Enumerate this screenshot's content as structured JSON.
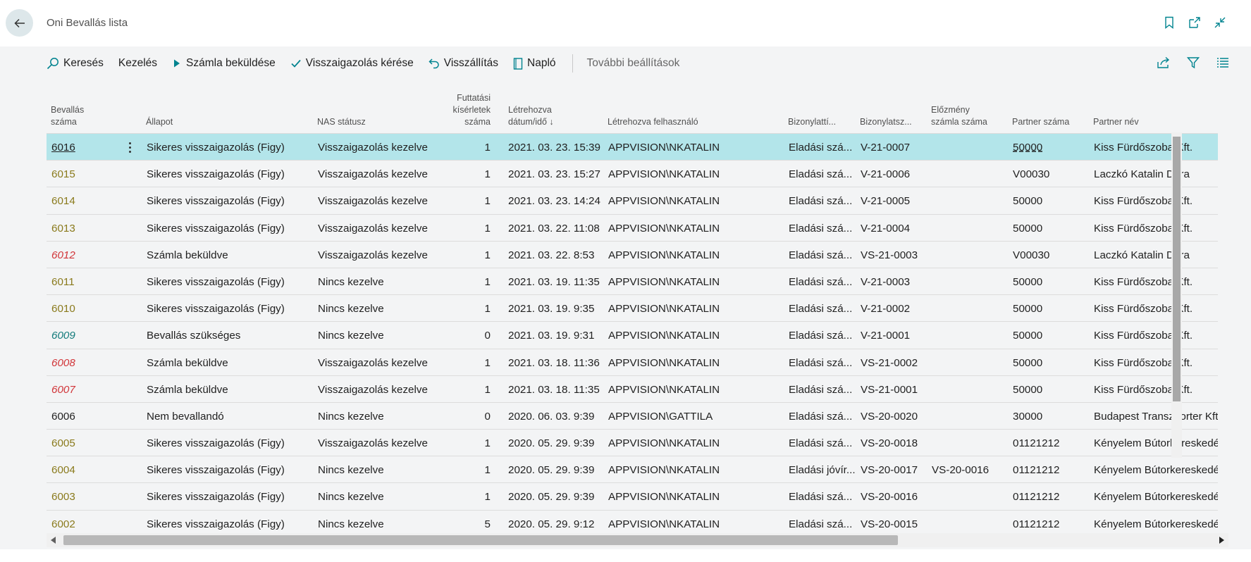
{
  "window": {
    "title": "Oni Bevallás lista",
    "title_icons": [
      "bookmark-icon",
      "open-new-window-icon",
      "collapse-icon"
    ]
  },
  "actions": {
    "search": "Keresés",
    "manage": "Kezelés",
    "send_invoice": "Számla beküldése",
    "request_confirmation": "Visszaigazolás kérése",
    "rollback": "Visszállítás",
    "log": "Napló",
    "more": "További beállítások"
  },
  "colors": {
    "accent": "#00838f",
    "selected_row": "#b3e5ea",
    "olive_link": "#8a7a1c",
    "red_link": "#d13438",
    "teal_link": "#117a7a"
  },
  "columns": [
    [
      "Bevallás",
      "száma"
    ],
    [
      "Állapot"
    ],
    [
      "NAS státusz"
    ],
    [
      "Futtatási",
      "kísérletek",
      "száma"
    ],
    [
      "Létrehozva",
      "dátum/idő ↓"
    ],
    [
      "Létrehozva felhasználó"
    ],
    [
      "Bizonylattí..."
    ],
    [
      "Bizonylatsz..."
    ],
    [
      "Előzmény",
      "számla száma"
    ],
    [
      "Partner száma"
    ],
    [
      "Partner név"
    ]
  ],
  "rows": [
    {
      "no": "6016",
      "no_style": "link",
      "status": "Sikeres visszaigazolás (Figy)",
      "nas": "Visszaigazolás kezelve",
      "attempts": "1",
      "created": "2021. 03. 23. 15:39",
      "user": "APPVISION\\NKATALIN",
      "doc_type": "Eladási szá...",
      "doc_no": "V-21-0007",
      "prev": "",
      "partner_no": "50000",
      "partner_name": "Kiss Fürdőszoba Kft."
    },
    {
      "no": "6015",
      "no_style": "olive",
      "status": "Sikeres visszaigazolás (Figy)",
      "nas": "Visszaigazolás kezelve",
      "attempts": "1",
      "created": "2021. 03. 23. 15:27",
      "user": "APPVISION\\NKATALIN",
      "doc_type": "Eladási szá...",
      "doc_no": "V-21-0006",
      "prev": "",
      "partner_no": "V00030",
      "partner_name": "Laczkó Katalin Dóra"
    },
    {
      "no": "6014",
      "no_style": "olive",
      "status": "Sikeres visszaigazolás (Figy)",
      "nas": "Visszaigazolás kezelve",
      "attempts": "1",
      "created": "2021. 03. 23. 14:24",
      "user": "APPVISION\\NKATALIN",
      "doc_type": "Eladási szá...",
      "doc_no": "V-21-0005",
      "prev": "",
      "partner_no": "50000",
      "partner_name": "Kiss Fürdőszoba Kft."
    },
    {
      "no": "6013",
      "no_style": "olive",
      "status": "Sikeres visszaigazolás (Figy)",
      "nas": "Visszaigazolás kezelve",
      "attempts": "1",
      "created": "2021. 03. 22. 11:08",
      "user": "APPVISION\\NKATALIN",
      "doc_type": "Eladási szá...",
      "doc_no": "V-21-0004",
      "prev": "",
      "partner_no": "50000",
      "partner_name": "Kiss Fürdőszoba Kft."
    },
    {
      "no": "6012",
      "no_style": "red",
      "status": "Számla beküldve",
      "nas": "Visszaigazolás kezelve",
      "attempts": "1",
      "created": "2021. 03. 22. 8:53",
      "user": "APPVISION\\NKATALIN",
      "doc_type": "Eladási szá...",
      "doc_no": "VS-21-0003",
      "prev": "",
      "partner_no": "V00030",
      "partner_name": "Laczkó Katalin Dóra"
    },
    {
      "no": "6011",
      "no_style": "olive",
      "status": "Sikeres visszaigazolás (Figy)",
      "nas": "Nincs kezelve",
      "attempts": "1",
      "created": "2021. 03. 19. 11:35",
      "user": "APPVISION\\NKATALIN",
      "doc_type": "Eladási szá...",
      "doc_no": "V-21-0003",
      "prev": "",
      "partner_no": "50000",
      "partner_name": "Kiss Fürdőszoba Kft."
    },
    {
      "no": "6010",
      "no_style": "olive",
      "status": "Sikeres visszaigazolás (Figy)",
      "nas": "Nincs kezelve",
      "attempts": "1",
      "created": "2021. 03. 19. 9:35",
      "user": "APPVISION\\NKATALIN",
      "doc_type": "Eladási szá...",
      "doc_no": "V-21-0002",
      "prev": "",
      "partner_no": "50000",
      "partner_name": "Kiss Fürdőszoba Kft."
    },
    {
      "no": "6009",
      "no_style": "teal",
      "status": "Bevallás szükséges",
      "nas": "Nincs kezelve",
      "attempts": "0",
      "created": "2021. 03. 19. 9:31",
      "user": "APPVISION\\NKATALIN",
      "doc_type": "Eladási szá...",
      "doc_no": "V-21-0001",
      "prev": "",
      "partner_no": "50000",
      "partner_name": "Kiss Fürdőszoba Kft."
    },
    {
      "no": "6008",
      "no_style": "red",
      "status": "Számla beküldve",
      "nas": "Visszaigazolás kezelve",
      "attempts": "1",
      "created": "2021. 03. 18. 11:36",
      "user": "APPVISION\\NKATALIN",
      "doc_type": "Eladási szá...",
      "doc_no": "VS-21-0002",
      "prev": "",
      "partner_no": "50000",
      "partner_name": "Kiss Fürdőszoba Kft."
    },
    {
      "no": "6007",
      "no_style": "red",
      "status": "Számla beküldve",
      "nas": "Visszaigazolás kezelve",
      "attempts": "1",
      "created": "2021. 03. 18. 11:35",
      "user": "APPVISION\\NKATALIN",
      "doc_type": "Eladási szá...",
      "doc_no": "VS-21-0001",
      "prev": "",
      "partner_no": "50000",
      "partner_name": "Kiss Fürdőszoba Kft."
    },
    {
      "no": "6006",
      "no_style": "plain",
      "status": "Nem bevallandó",
      "nas": "Nincs kezelve",
      "attempts": "0",
      "created": "2020. 06. 03. 9:39",
      "user": "APPVISION\\GATTILA",
      "doc_type": "Eladási szá...",
      "doc_no": "VS-20-0020",
      "prev": "",
      "partner_no": "30000",
      "partner_name": "Budapest Transzporter Kft."
    },
    {
      "no": "6005",
      "no_style": "olive",
      "status": "Sikeres visszaigazolás (Figy)",
      "nas": "Visszaigazolás kezelve",
      "attempts": "1",
      "created": "2020. 05. 29. 9:39",
      "user": "APPVISION\\NKATALIN",
      "doc_type": "Eladási szá...",
      "doc_no": "VS-20-0018",
      "prev": "",
      "partner_no": "01121212",
      "partner_name": "Kényelem Bútorkereskedés"
    },
    {
      "no": "6004",
      "no_style": "olive",
      "status": "Sikeres visszaigazolás (Figy)",
      "nas": "Nincs kezelve",
      "attempts": "1",
      "created": "2020. 05. 29. 9:39",
      "user": "APPVISION\\NKATALIN",
      "doc_type": "Eladási jóvír...",
      "doc_no": "VS-20-0017",
      "prev": "VS-20-0016",
      "partner_no": "01121212",
      "partner_name": "Kényelem Bútorkereskedés"
    },
    {
      "no": "6003",
      "no_style": "olive",
      "status": "Sikeres visszaigazolás (Figy)",
      "nas": "Nincs kezelve",
      "attempts": "1",
      "created": "2020. 05. 29. 9:39",
      "user": "APPVISION\\NKATALIN",
      "doc_type": "Eladási szá...",
      "doc_no": "VS-20-0016",
      "prev": "",
      "partner_no": "01121212",
      "partner_name": "Kényelem Bútorkereskedés"
    },
    {
      "no": "6002",
      "no_style": "olive",
      "status": "Sikeres visszaigazolás (Figy)",
      "nas": "Nincs kezelve",
      "attempts": "5",
      "created": "2020. 05. 29. 9:12",
      "user": "APPVISION\\NKATALIN",
      "doc_type": "Eladási szá...",
      "doc_no": "VS-20-0015",
      "prev": "",
      "partner_no": "01121212",
      "partner_name": "Kényelem Bútorkereskedés"
    }
  ]
}
